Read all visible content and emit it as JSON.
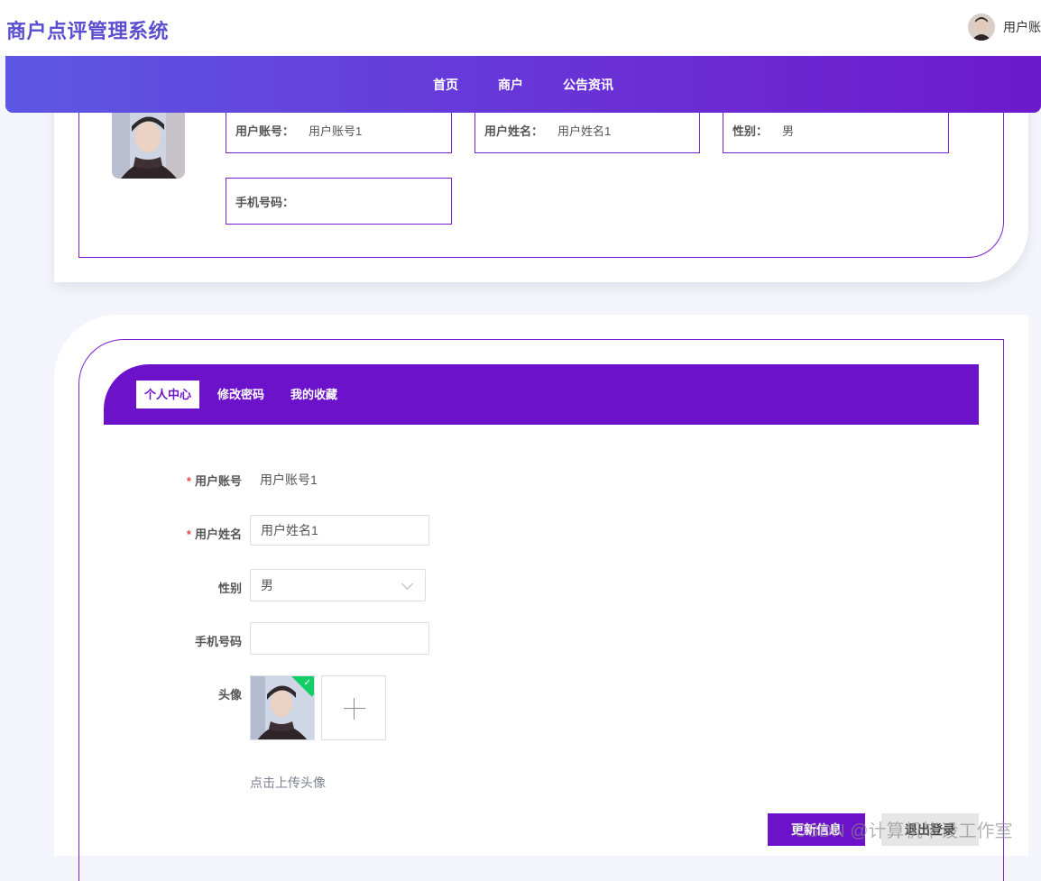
{
  "app": {
    "title": "商户点评管理系统"
  },
  "user": {
    "name": "用户账"
  },
  "nav": {
    "items": [
      "首页",
      "商户",
      "公告资讯"
    ]
  },
  "profile": {
    "account_label": "用户账号：",
    "account_value": "用户账号1",
    "name_label": "用户姓名：",
    "name_value": "用户姓名1",
    "gender_label": "性别：",
    "gender_value": "男",
    "phone_label": "手机号码：",
    "phone_value": ""
  },
  "tabs": [
    "个人中心",
    "修改密码",
    "我的收藏"
  ],
  "form": {
    "account_label": "用户账号",
    "account_value": "用户账号1",
    "name_label": "用户姓名",
    "name_value": "用户姓名1",
    "gender_label": "性别",
    "gender_value": "男",
    "phone_label": "手机号码",
    "phone_value": "",
    "avatar_label": "头像",
    "upload_hint": "点击上传头像",
    "required_mark": "*"
  },
  "buttons": {
    "update": "更新信息",
    "logout": "退出登录"
  },
  "watermark": "CSDN @计算机毕设工作室",
  "colors": {
    "accent": "#6d12cb",
    "brand_text": "#5b4fcf",
    "success": "#13ce66",
    "required": "#f04848"
  },
  "icons": [
    "avatar-photo",
    "chevron-down-icon",
    "plus-icon",
    "check-icon"
  ]
}
